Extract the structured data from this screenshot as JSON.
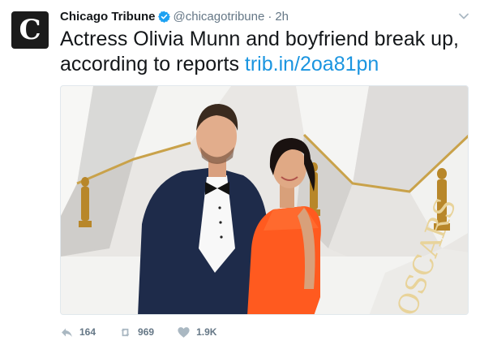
{
  "tweet": {
    "author": {
      "name": "Chicago Tribune",
      "handle": "@chicagotribune",
      "avatar_glyph": "C",
      "verified_icon": "verified-badge-icon"
    },
    "separator": "·",
    "timestamp": "2h",
    "text": "Actress Olivia Munn and boyfriend break up, according to reports ",
    "link": "trib.in/2oa81pn",
    "actions": {
      "reply_count": "164",
      "retweet_count": "969",
      "like_count": "1.9K"
    },
    "colors": {
      "link": "#1b95e0",
      "secondary_text": "#657786",
      "verified": "#1da1f2"
    }
  }
}
